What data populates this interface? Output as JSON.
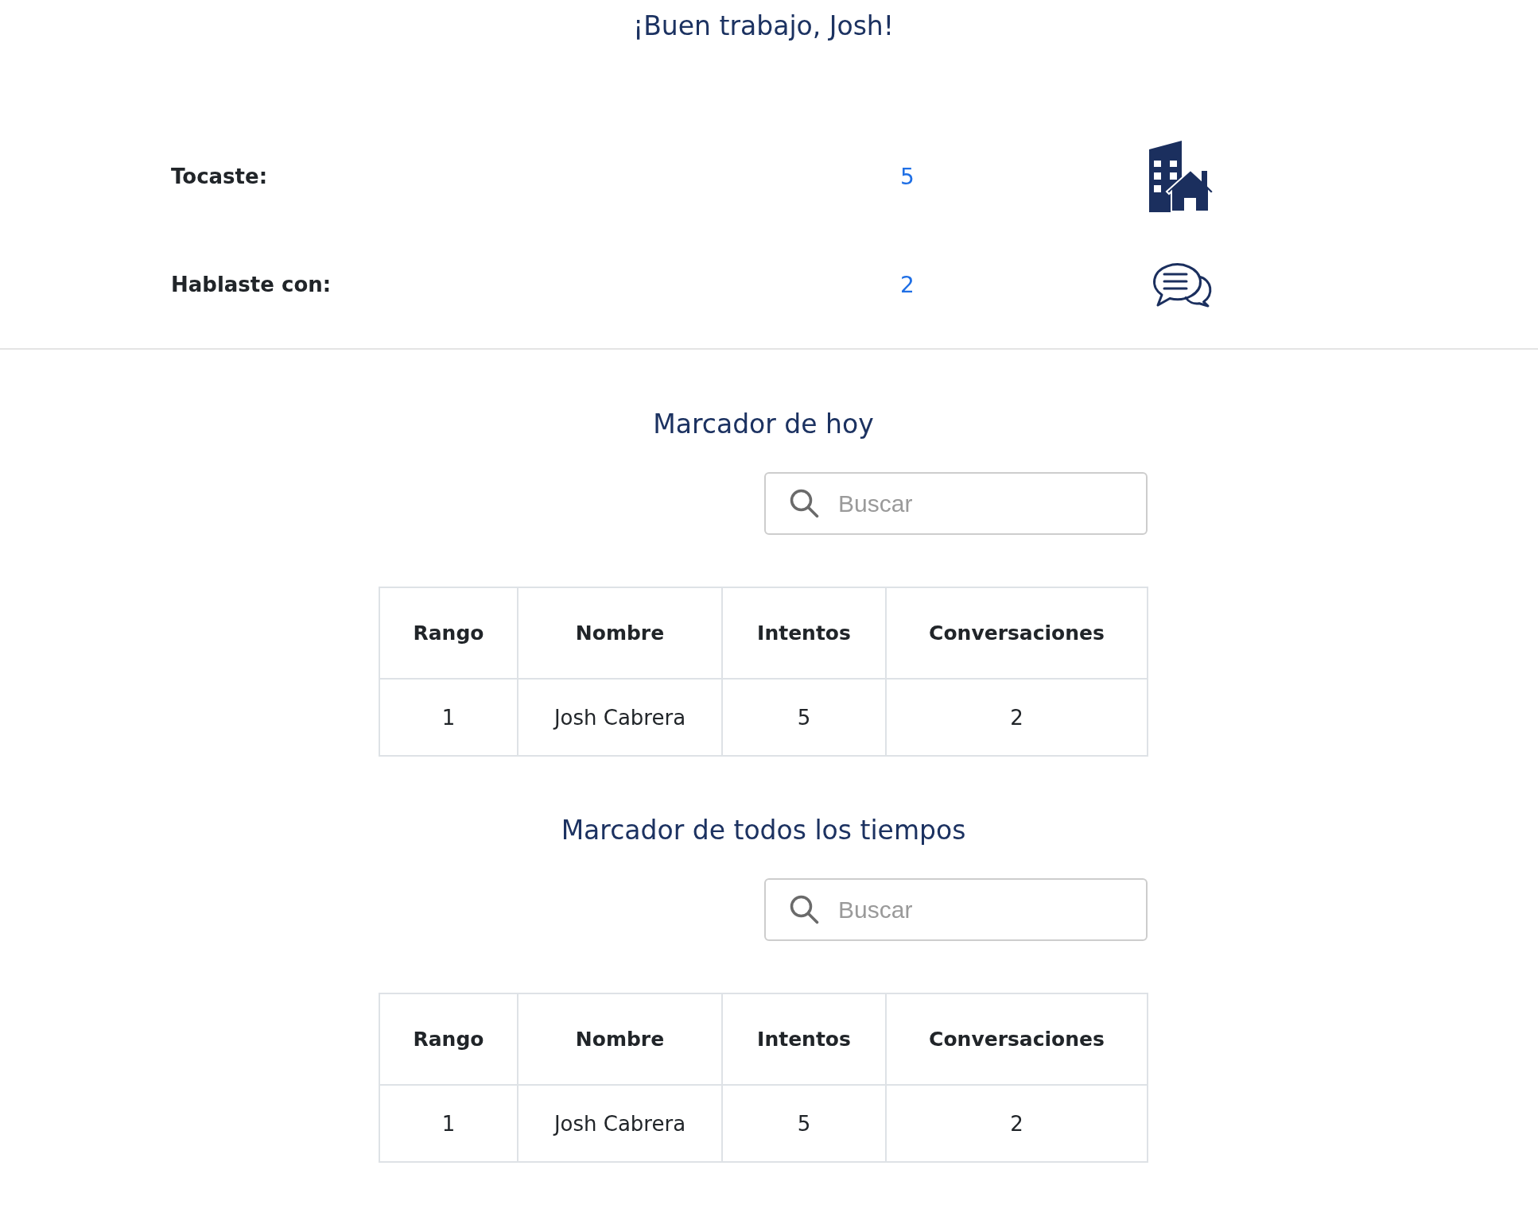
{
  "title": "¡Buen trabajo, Josh!",
  "stats": [
    {
      "label": "Tocaste:",
      "value": "5",
      "kind": "building"
    },
    {
      "label": "Hablaste con:",
      "value": "2",
      "kind": "chat"
    }
  ],
  "leaderboards": [
    {
      "heading": "Marcador de hoy",
      "search": {
        "placeholder": "Buscar"
      },
      "columns": [
        "Rango",
        "Nombre",
        "Intentos",
        "Conversaciones"
      ],
      "rows": [
        [
          "1",
          "Josh Cabrera",
          "5",
          "2"
        ]
      ]
    },
    {
      "heading": "Marcador de todos los tiempos",
      "search": {
        "placeholder": "Buscar"
      },
      "columns": [
        "Rango",
        "Nombre",
        "Intentos",
        "Conversaciones"
      ],
      "rows": [
        [
          "1",
          "Josh Cabrera",
          "5",
          "2"
        ]
      ]
    }
  ]
}
